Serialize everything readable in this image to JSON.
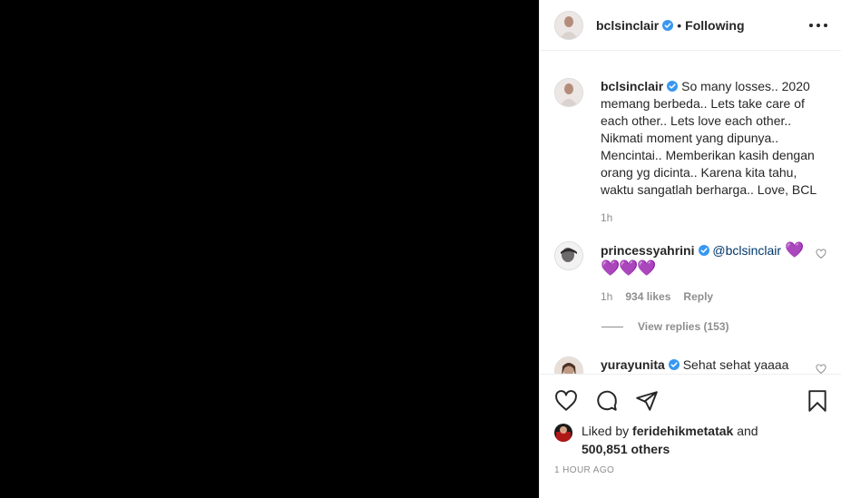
{
  "header": {
    "username": "bclsinclair",
    "separator": "•",
    "follow_label": "Following",
    "more_icon": "more-dots-icon"
  },
  "caption": {
    "username": "bclsinclair",
    "text": "So many losses.. 2020 memang berbeda.. Lets take care of each other.. Lets love each other.. Nikmati moment yang dipunya.. Mencintai.. Memberikan kasih dengan orang yg dicinta.. Karena kita tahu, waktu sangatlah berharga.. Love, BCL",
    "time": "1h"
  },
  "comments": [
    {
      "username": "princessyahrini",
      "mention": "@bclsinclair",
      "emoji": "💜💜💜💜",
      "time": "1h",
      "likes": "934 likes",
      "reply_label": "Reply",
      "view_replies": "View replies (153)"
    },
    {
      "username": "yurayunita",
      "text": "Sehat sehat yaaaa"
    }
  ],
  "actions": {
    "like_icon": "heart-icon",
    "comment_icon": "comment-icon",
    "share_icon": "paper-plane-icon",
    "save_icon": "bookmark-icon"
  },
  "likes": {
    "prefix": "Liked by",
    "user": "feridehikmetatak",
    "and": "and",
    "others": "500,851 others"
  },
  "timestamp": "1 HOUR AGO",
  "colors": {
    "verified": "#3897f0",
    "mention": "#00376b",
    "muted": "#8e8e8e",
    "purple_heart": "#a035e9"
  }
}
